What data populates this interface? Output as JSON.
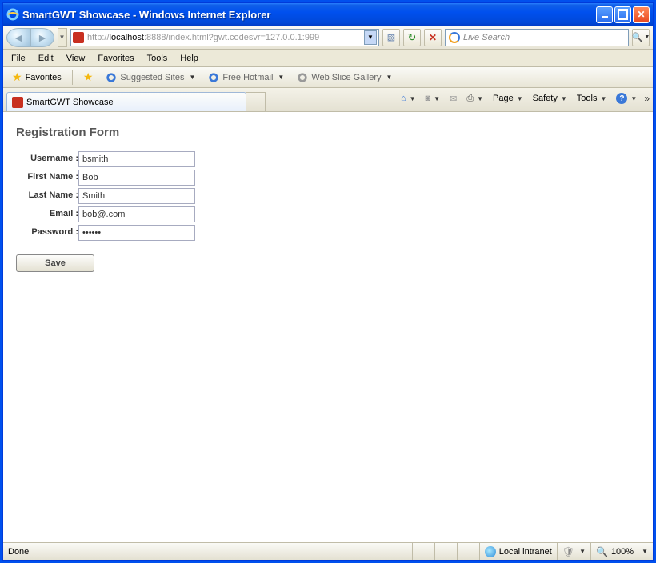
{
  "window": {
    "title": "SmartGWT Showcase - Windows Internet Explorer"
  },
  "address": {
    "prefix": "http://",
    "host": "localhost",
    "rest": ":8888/index.html?gwt.codesvr=127.0.0.1:999"
  },
  "search": {
    "placeholder": "Live Search"
  },
  "menus": [
    "File",
    "Edit",
    "View",
    "Favorites",
    "Tools",
    "Help"
  ],
  "favbar": {
    "label": "Favorites",
    "links": [
      "Suggested Sites",
      "Free Hotmail",
      "Web Slice Gallery"
    ]
  },
  "tab": {
    "title": "SmartGWT Showcase"
  },
  "cmdbar": {
    "page": "Page",
    "safety": "Safety",
    "tools": "Tools"
  },
  "form": {
    "title": "Registration Form",
    "labels": {
      "username": "Username :",
      "firstname": "First Name :",
      "lastname": "Last Name :",
      "email": "Email :",
      "password": "Password :"
    },
    "values": {
      "username": "bsmith",
      "firstname": "Bob",
      "lastname": "Smith",
      "email": "bob@.com",
      "password": "••••••"
    },
    "save": "Save"
  },
  "status": {
    "left": "Done",
    "zone": "Local intranet",
    "zoom": "100%"
  }
}
